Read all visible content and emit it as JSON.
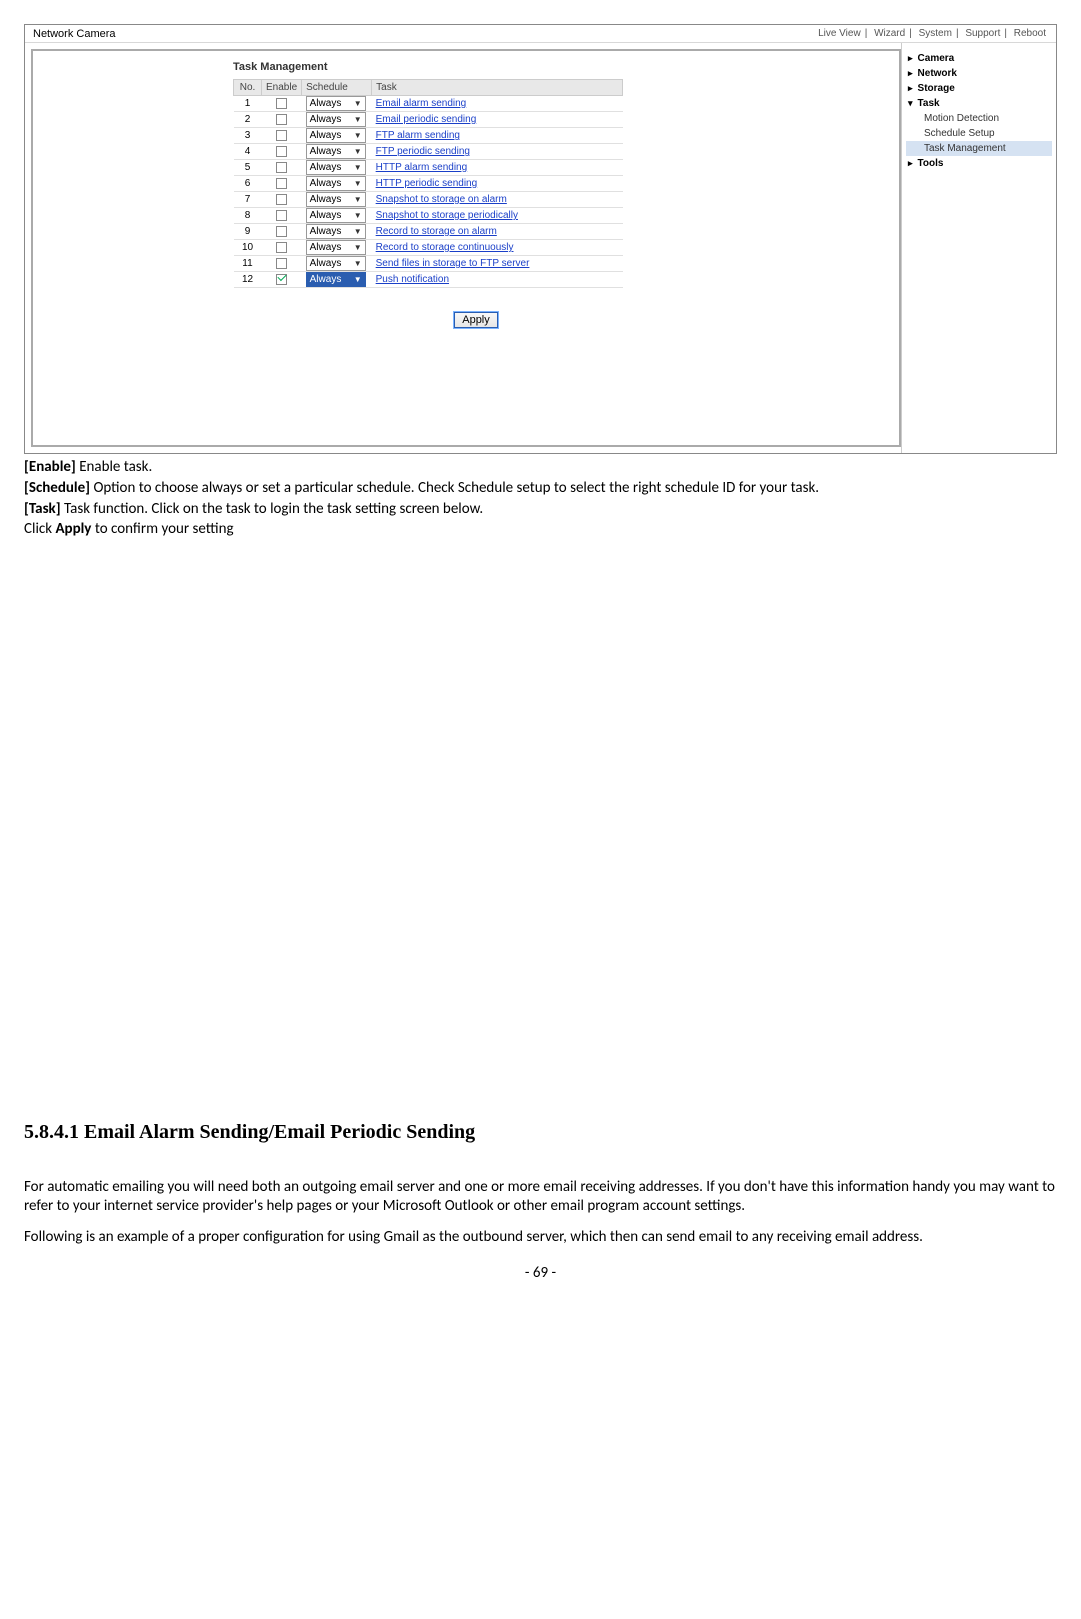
{
  "screenshot": {
    "title": "Network Camera",
    "topnav": [
      "Live View",
      "Wizard",
      "System",
      "Support",
      "Reboot"
    ],
    "section_title": "Task Management",
    "headers": {
      "no": "No.",
      "enable": "Enable",
      "schedule": "Schedule",
      "task": "Task"
    },
    "rows": [
      {
        "no": "1",
        "checked": false,
        "schedule": "Always",
        "task": "Email alarm sending",
        "selActive": false
      },
      {
        "no": "2",
        "checked": false,
        "schedule": "Always",
        "task": "Email periodic sending",
        "selActive": false
      },
      {
        "no": "3",
        "checked": false,
        "schedule": "Always",
        "task": "FTP alarm sending",
        "selActive": false
      },
      {
        "no": "4",
        "checked": false,
        "schedule": "Always",
        "task": "FTP periodic sending",
        "selActive": false
      },
      {
        "no": "5",
        "checked": false,
        "schedule": "Always",
        "task": "HTTP alarm sending",
        "selActive": false
      },
      {
        "no": "6",
        "checked": false,
        "schedule": "Always",
        "task": "HTTP periodic sending",
        "selActive": false
      },
      {
        "no": "7",
        "checked": false,
        "schedule": "Always",
        "task": "Snapshot to storage on alarm",
        "selActive": false
      },
      {
        "no": "8",
        "checked": false,
        "schedule": "Always",
        "task": "Snapshot to storage periodically",
        "selActive": false
      },
      {
        "no": "9",
        "checked": false,
        "schedule": "Always",
        "task": "Record to storage on alarm",
        "selActive": false
      },
      {
        "no": "10",
        "checked": false,
        "schedule": "Always",
        "task": "Record to storage continuously",
        "selActive": false
      },
      {
        "no": "11",
        "checked": false,
        "schedule": "Always",
        "task": "Send files in storage to FTP server",
        "selActive": false
      },
      {
        "no": "12",
        "checked": true,
        "schedule": "Always",
        "task": "Push notification",
        "selActive": true
      }
    ],
    "apply_label": "Apply",
    "sidebar": {
      "camera": "Camera",
      "network": "Network",
      "storage": "Storage",
      "task": "Task",
      "task_children": {
        "motion": "Motion Detection",
        "schedule": "Schedule Setup",
        "mgmt": "Task Management"
      },
      "tools": "Tools"
    }
  },
  "doc": {
    "p1_bold": "[Enable]",
    "p1_rest": " Enable task.",
    "p2_bold": "[Schedule]",
    "p2_rest": " Option to choose always or set a particular schedule. Check Schedule setup to select the right schedule ID for your task.",
    "p3_bold": "[Task]",
    "p3_rest": " Task function. Click on the task to login the task setting screen below.",
    "p4_pre": "Click ",
    "p4_bold": "Apply",
    "p4_post": " to confirm your setting",
    "heading": "5.8.4.1 Email Alarm Sending/Email Periodic Sending",
    "p5": "For automatic emailing you will need both an outgoing email server and one or more email receiving addresses. If you don't have this information handy you may want to refer to your internet service provider's help pages or your Microsoft Outlook or other email program account settings.",
    "p6": "Following is an example of a proper configuration for using Gmail as the outbound server, which then can send email to any receiving email address.",
    "page": "- 69 -"
  }
}
